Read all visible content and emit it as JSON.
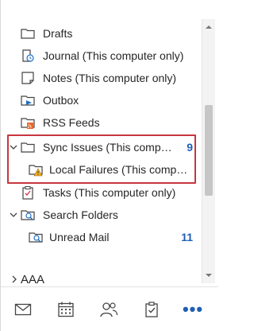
{
  "folders": [
    {
      "label": "Drafts",
      "icon": "folder-icon"
    },
    {
      "label": "Journal (This computer only)",
      "icon": "journal-icon"
    },
    {
      "label": "Notes (This computer only)",
      "icon": "note-icon"
    },
    {
      "label": "Outbox",
      "icon": "outbox-icon"
    },
    {
      "label": "RSS Feeds",
      "icon": "rss-folder-icon"
    },
    {
      "label": "Sync Issues (This computer only)",
      "icon": "folder-icon",
      "count": "9",
      "expanded": true
    },
    {
      "label": "Local Failures (This computer only)",
      "icon": "warning-folder-icon"
    },
    {
      "label": "Tasks (This computer only)",
      "icon": "tasks-icon"
    },
    {
      "label": "Search Folders",
      "icon": "search-folder-icon",
      "expanded": true
    },
    {
      "label": "Unread Mail",
      "icon": "search-folder-icon",
      "count": "11"
    }
  ],
  "account": {
    "label": "AAA",
    "expanded": false
  },
  "bottom_nav": [
    "mail-icon",
    "calendar-icon",
    "people-icon",
    "tasks-icon",
    "more-icon"
  ],
  "more_label": "•••",
  "colors": {
    "accent": "#1f5fb4",
    "highlight": "#c8363f"
  }
}
